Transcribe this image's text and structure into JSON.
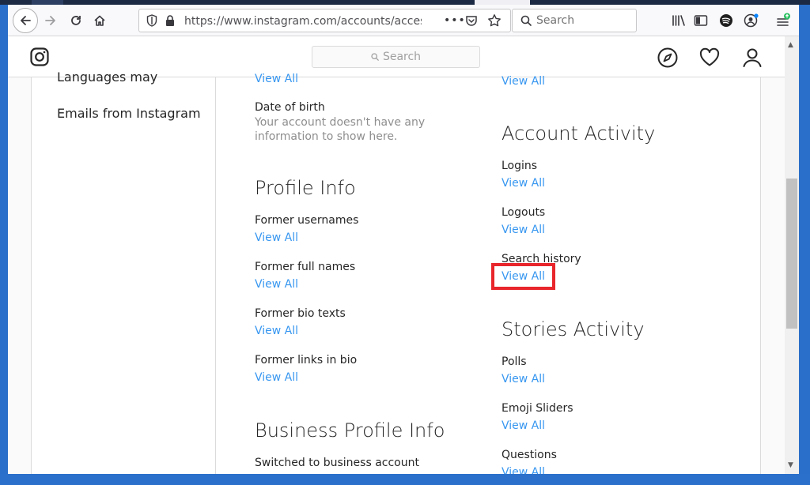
{
  "browser": {
    "url": "https://www.instagram.com/accounts/access_to",
    "url_overflow": "•••",
    "search_placeholder": "Search"
  },
  "instagram": {
    "search_placeholder": "Search"
  },
  "sidebar": {
    "partial_item": "Languages may",
    "items": [
      {
        "label": "Emails from Instagram"
      }
    ]
  },
  "middle": {
    "top_link": "View All",
    "date_of_birth": {
      "label": "Date of birth",
      "note": "Your account doesn't have any information to show here."
    },
    "profile_info": {
      "heading": "Profile Info",
      "rows": [
        {
          "label": "Former usernames",
          "link": "View All"
        },
        {
          "label": "Former full names",
          "link": "View All"
        },
        {
          "label": "Former bio texts",
          "link": "View All"
        },
        {
          "label": "Former links in bio",
          "link": "View All"
        }
      ]
    },
    "business_profile_info": {
      "heading": "Business Profile Info",
      "rows": [
        {
          "label": "Switched to business account"
        }
      ]
    }
  },
  "right": {
    "top_link": "View All",
    "account_activity": {
      "heading": "Account Activity",
      "rows": [
        {
          "label": "Logins",
          "link": "View All"
        },
        {
          "label": "Logouts",
          "link": "View All"
        },
        {
          "label": "Search history",
          "link": "View All"
        }
      ]
    },
    "stories_activity": {
      "heading": "Stories Activity",
      "rows": [
        {
          "label": "Polls",
          "link": "View All"
        },
        {
          "label": "Emoji Sliders",
          "link": "View All"
        },
        {
          "label": "Questions",
          "link": "View All"
        }
      ]
    }
  },
  "colors": {
    "link": "#3897f0",
    "highlight": "#e8262b",
    "text": "#262626",
    "muted": "#8e8e8e",
    "desktop": "#2a6fc9"
  }
}
